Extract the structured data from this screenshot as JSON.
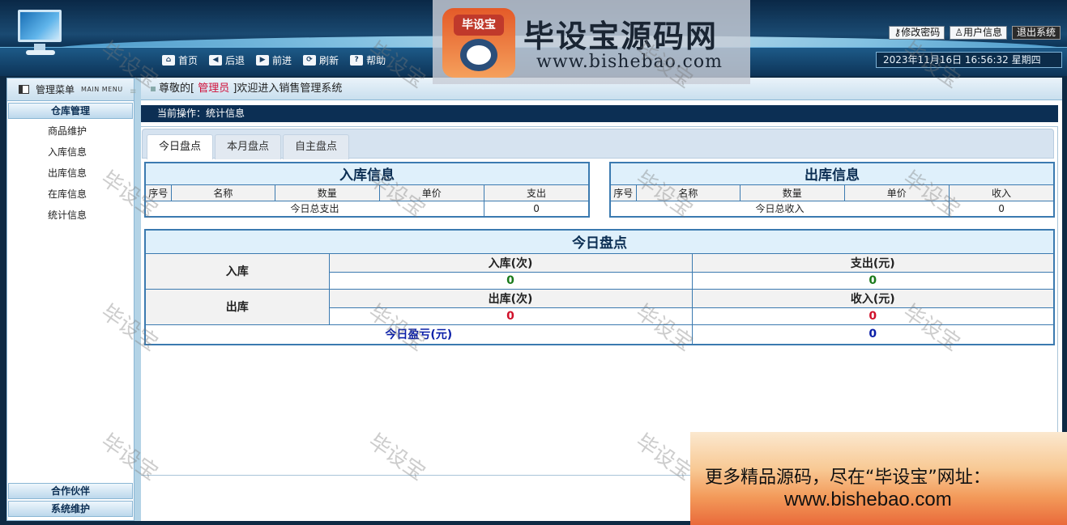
{
  "header": {
    "nav": [
      {
        "label": "首页",
        "icon": "home-icon",
        "glyph": "⌂"
      },
      {
        "label": "后退",
        "icon": "back-arrow-icon",
        "glyph": "◀"
      },
      {
        "label": "前进",
        "icon": "forward-arrow-icon",
        "glyph": "▶"
      },
      {
        "label": "刷新",
        "icon": "refresh-icon",
        "glyph": "⟳"
      },
      {
        "label": "帮助",
        "icon": "help-icon",
        "glyph": "?"
      }
    ],
    "links": {
      "change_password": "修改密码",
      "user_info": "用户信息",
      "logout": "退出系统"
    },
    "clock": "2023年11月16日 16:56:32 星期四"
  },
  "logo": {
    "title": "毕设宝源码网",
    "badge": "毕设宝",
    "url": "www.bishebao.com"
  },
  "sidebar": {
    "title": "管理菜单",
    "title_en": "MAIN MENU",
    "groups": [
      {
        "label": "仓库管理",
        "items": [
          "商品维护",
          "入库信息",
          "出库信息",
          "在库信息",
          "统计信息"
        ]
      }
    ],
    "bottom_groups": [
      "合作伙伴",
      "系统维护"
    ]
  },
  "welcome": {
    "prefix": "尊敬的[",
    "role": " 管理员 ",
    "suffix": "]欢迎进入销售管理系统"
  },
  "current_op": "当前操作：统计信息",
  "tabs": [
    "今日盘点",
    "本月盘点",
    "自主盘点"
  ],
  "inbound": {
    "title": "入库信息",
    "columns": [
      "序号",
      "名称",
      "数量",
      "单价",
      "支出"
    ],
    "total_label": "今日总支出",
    "total_value": "0"
  },
  "outbound": {
    "title": "出库信息",
    "columns": [
      "序号",
      "名称",
      "数量",
      "单价",
      "收入"
    ],
    "total_label": "今日总收入",
    "total_value": "0"
  },
  "summary": {
    "title": "今日盘点",
    "in_label": "入库",
    "in_count_label": "入库(次)",
    "in_count": "0",
    "expense_label": "支出(元)",
    "expense": "0",
    "out_label": "出库",
    "out_count_label": "出库(次)",
    "out_count": "0",
    "income_label": "收入(元)",
    "income": "0",
    "profit_label": "今日盈亏(元)",
    "profit": "0"
  },
  "watermark": "毕设宝",
  "ad": {
    "line1": "更多精品源码，尽在“毕设宝”网址：",
    "line2": "www.bishebao.com"
  }
}
